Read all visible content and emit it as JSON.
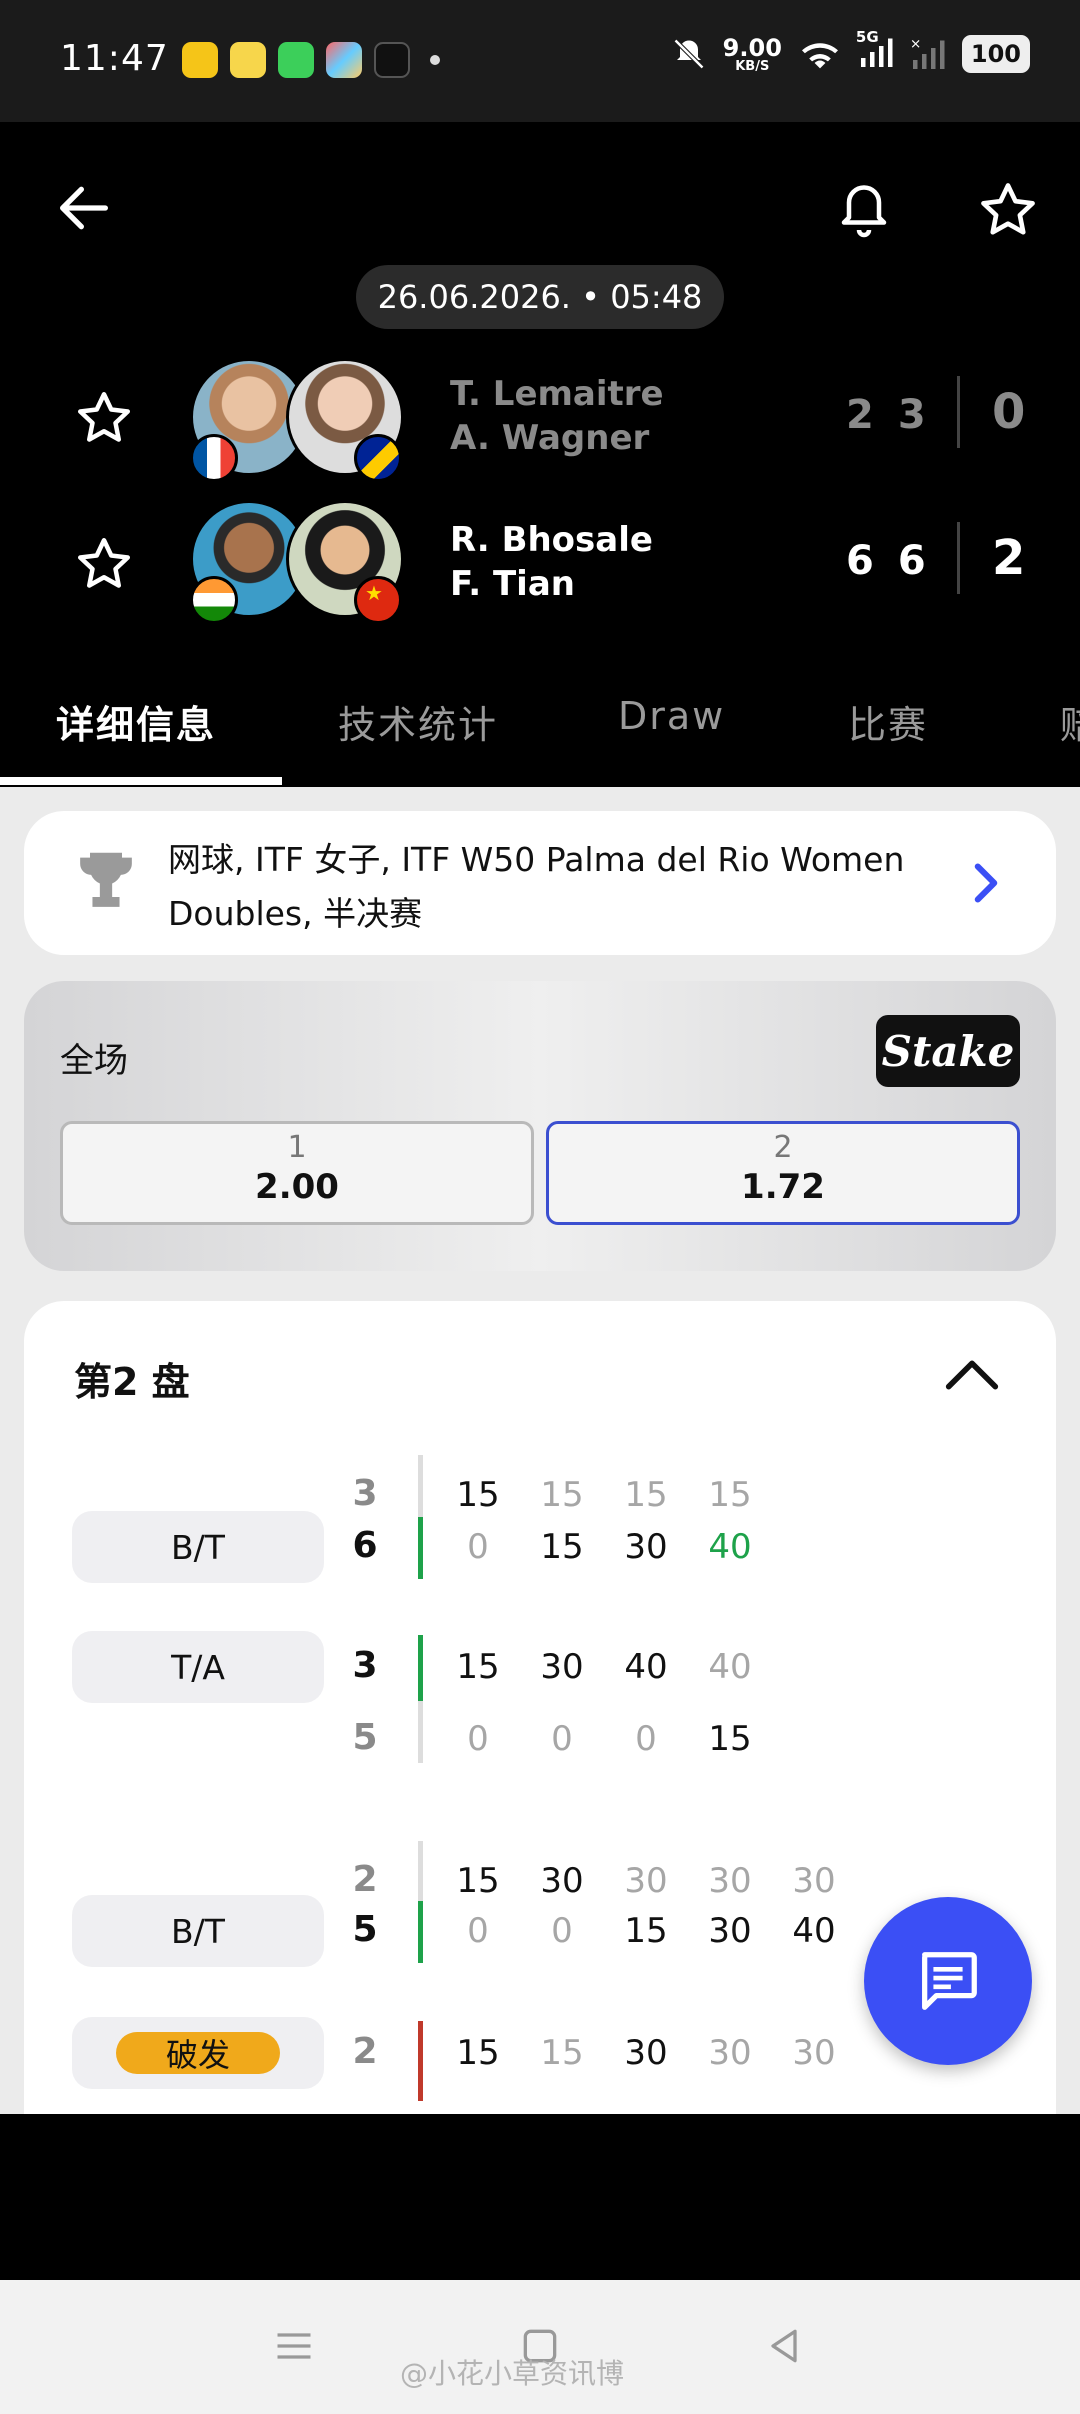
{
  "status_bar": {
    "time": "11:47",
    "speed_value": "9.00",
    "speed_unit": "KB/S",
    "network": "5G",
    "battery": "100"
  },
  "header": {
    "datetime": "26.06.2026. • 05:48",
    "teams": [
      {
        "player1": "T. Lemaitre",
        "player2": "A. Wagner",
        "games": [
          "2",
          "3"
        ],
        "sets": "0",
        "flags": [
          "france-flag",
          "bosnia-flag"
        ]
      },
      {
        "player1": "R. Bhosale",
        "player2": "F. Tian",
        "games": [
          "6",
          "6"
        ],
        "sets": "2",
        "flags": [
          "india-flag",
          "china-flag"
        ]
      }
    ]
  },
  "tabs": [
    "详细信息",
    "技术统计",
    "Draw",
    "比赛",
    "赔"
  ],
  "league": {
    "line1": "网球, ITF 女子, ITF W50 Palma del Rio Women",
    "line2": "Doubles, 半决赛"
  },
  "odds": {
    "title": "全场",
    "brand": "Stake",
    "options": [
      {
        "label": "1",
        "value": "2.00"
      },
      {
        "label": "2",
        "value": "1.72"
      }
    ]
  },
  "set_section": {
    "title": "第2 盘",
    "games": [
      {
        "server_pill": "B/T",
        "rows": [
          {
            "games": "3",
            "points": [
              "15",
              "15",
              "15",
              "15"
            ]
          },
          {
            "games": "6",
            "points": [
              "0",
              "15",
              "30",
              "40"
            ]
          }
        ]
      },
      {
        "server_pill": "T/A",
        "rows": [
          {
            "games": "3",
            "points": [
              "15",
              "30",
              "40",
              "40"
            ]
          },
          {
            "games": "5",
            "points": [
              "0",
              "0",
              "0",
              "15"
            ]
          }
        ]
      },
      {
        "server_pill": "B/T",
        "rows": [
          {
            "games": "2",
            "points": [
              "15",
              "30",
              "30",
              "30",
              "30"
            ]
          },
          {
            "games": "5",
            "points": [
              "0",
              "0",
              "15",
              "30",
              "40"
            ]
          }
        ]
      },
      {
        "server_pill": "破发",
        "rows": [
          {
            "games": "2",
            "points": [
              "15",
              "15",
              "30",
              "30",
              "30"
            ]
          }
        ]
      }
    ]
  },
  "watermark": "@小花小草资讯博",
  "colors": {
    "accent_blue": "#3b4ff5",
    "win_green": "#1ea24a",
    "break_orange": "#f0a91b",
    "loss_red": "#c0392b"
  }
}
